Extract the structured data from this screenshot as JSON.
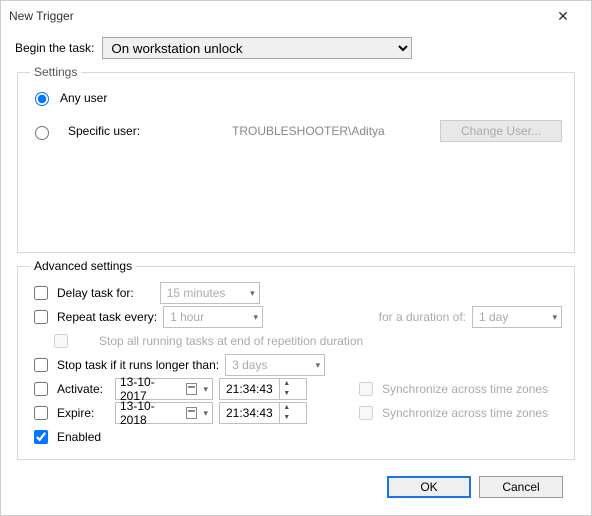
{
  "window": {
    "title": "New Trigger"
  },
  "begin": {
    "label": "Begin the task:",
    "value": "On workstation unlock"
  },
  "settings": {
    "legend": "Settings",
    "any_user": "Any user",
    "specific_user": "Specific user:",
    "specific_user_value": "TROUBLESHOOTER\\Aditya",
    "change_user": "Change User..."
  },
  "advanced": {
    "legend": "Advanced settings",
    "delay_label": "Delay task for:",
    "delay_value": "15 minutes",
    "repeat_label": "Repeat task every:",
    "repeat_value": "1 hour",
    "duration_label": "for a duration of:",
    "duration_value": "1 day",
    "stop_all": "Stop all running tasks at end of repetition duration",
    "stop_longer_label": "Stop task if it runs longer than:",
    "stop_longer_value": "3 days",
    "activate_label": "Activate:",
    "activate_date": "13-10-2017",
    "activate_time": "21:34:43",
    "expire_label": "Expire:",
    "expire_date": "13-10-2018",
    "expire_time": "21:34:43",
    "sync_label": "Synchronize across time zones",
    "enabled_label": "Enabled"
  },
  "footer": {
    "ok": "OK",
    "cancel": "Cancel"
  }
}
